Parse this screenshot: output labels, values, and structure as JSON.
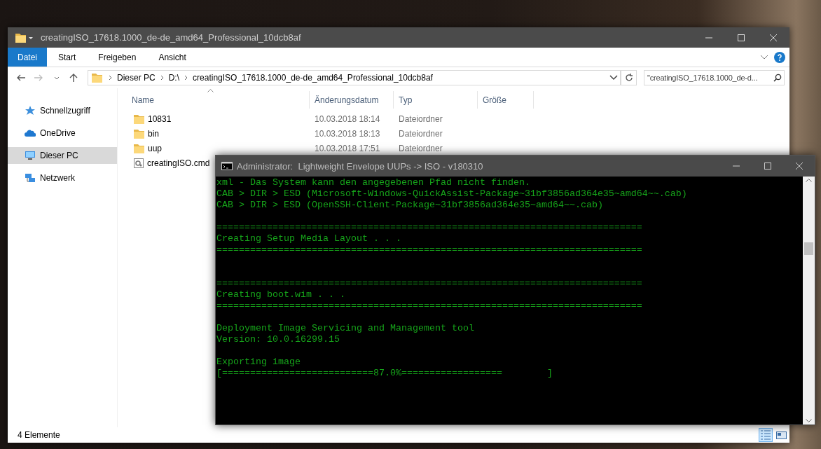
{
  "explorer": {
    "title": "creatingISO_17618.1000_de-de_amd64_Professional_10dcb8af",
    "ribbon_tabs": [
      {
        "label": "Datei",
        "selected": true
      },
      {
        "label": "Start",
        "selected": false
      },
      {
        "label": "Freigeben",
        "selected": false
      },
      {
        "label": "Ansicht",
        "selected": false
      }
    ],
    "breadcrumbs": [
      "Dieser PC",
      "D:\\",
      "creatingISO_17618.1000_de-de_amd64_Professional_10dcb8af"
    ],
    "search": {
      "placeholder": "\"creatingISO_17618.1000_de-d..."
    },
    "sidebar": {
      "items": [
        {
          "label": "Schnellzugriff",
          "kind": "star",
          "selected": false
        },
        {
          "label": "OneDrive",
          "kind": "cloud",
          "selected": false
        },
        {
          "label": "Dieser PC",
          "kind": "computer",
          "selected": true
        },
        {
          "label": "Netzwerk",
          "kind": "network",
          "selected": false
        }
      ]
    },
    "table": {
      "columns": [
        "Name",
        "Änderungsdatum",
        "Typ",
        "Größe"
      ],
      "rows": [
        {
          "kind": "folder",
          "name": "10831",
          "date": "10.03.2018 18:14",
          "type": "Dateiordner"
        },
        {
          "kind": "folder",
          "name": "bin",
          "date": "10.03.2018 18:13",
          "type": "Dateiordner"
        },
        {
          "kind": "folder",
          "name": "uup",
          "date": "10.03.2018 17:51",
          "type": "Dateiordner"
        },
        {
          "kind": "script",
          "name": "creatingISO.cmd"
        }
      ]
    },
    "status_bar": {
      "text": "4 Elemente",
      "view_modes": [
        {
          "kind": "details",
          "selected": true
        },
        {
          "kind": "tiles",
          "selected": false
        }
      ]
    }
  },
  "console": {
    "title": "Administrator:  Lightweight Envelope UUPs -> ISO - v180310",
    "lines": [
      {
        "kind": "text",
        "text": "xml - Das System kann den angegebenen Pfad nicht finden."
      },
      {
        "kind": "text",
        "text": "CAB > DIR > ESD (Microsoft-Windows-QuickAssist-Package~31bf3856ad364e35~amd64~~.cab)"
      },
      {
        "kind": "text",
        "text": "CAB > DIR > ESD (OpenSSH-Client-Package~31bf3856ad364e35~amd64~~.cab)"
      },
      {
        "kind": "blank"
      },
      {
        "kind": "text",
        "text": "============================================================================"
      },
      {
        "kind": "text",
        "text": "Creating Setup Media Layout . . ."
      },
      {
        "kind": "text",
        "text": "============================================================================"
      },
      {
        "kind": "blank"
      },
      {
        "kind": "blank"
      },
      {
        "kind": "text",
        "text": "============================================================================"
      },
      {
        "kind": "text",
        "text": "Creating boot.wim . . ."
      },
      {
        "kind": "text",
        "text": "============================================================================"
      },
      {
        "kind": "blank"
      },
      {
        "kind": "text",
        "text": "Deployment Image Servicing and Management tool"
      },
      {
        "kind": "text",
        "text": "Version: 10.0.16299.15"
      },
      {
        "kind": "blank"
      },
      {
        "kind": "text",
        "text": "Exporting image"
      },
      {
        "kind": "text",
        "text": "[===========================87.0%==================        ]"
      }
    ]
  }
}
